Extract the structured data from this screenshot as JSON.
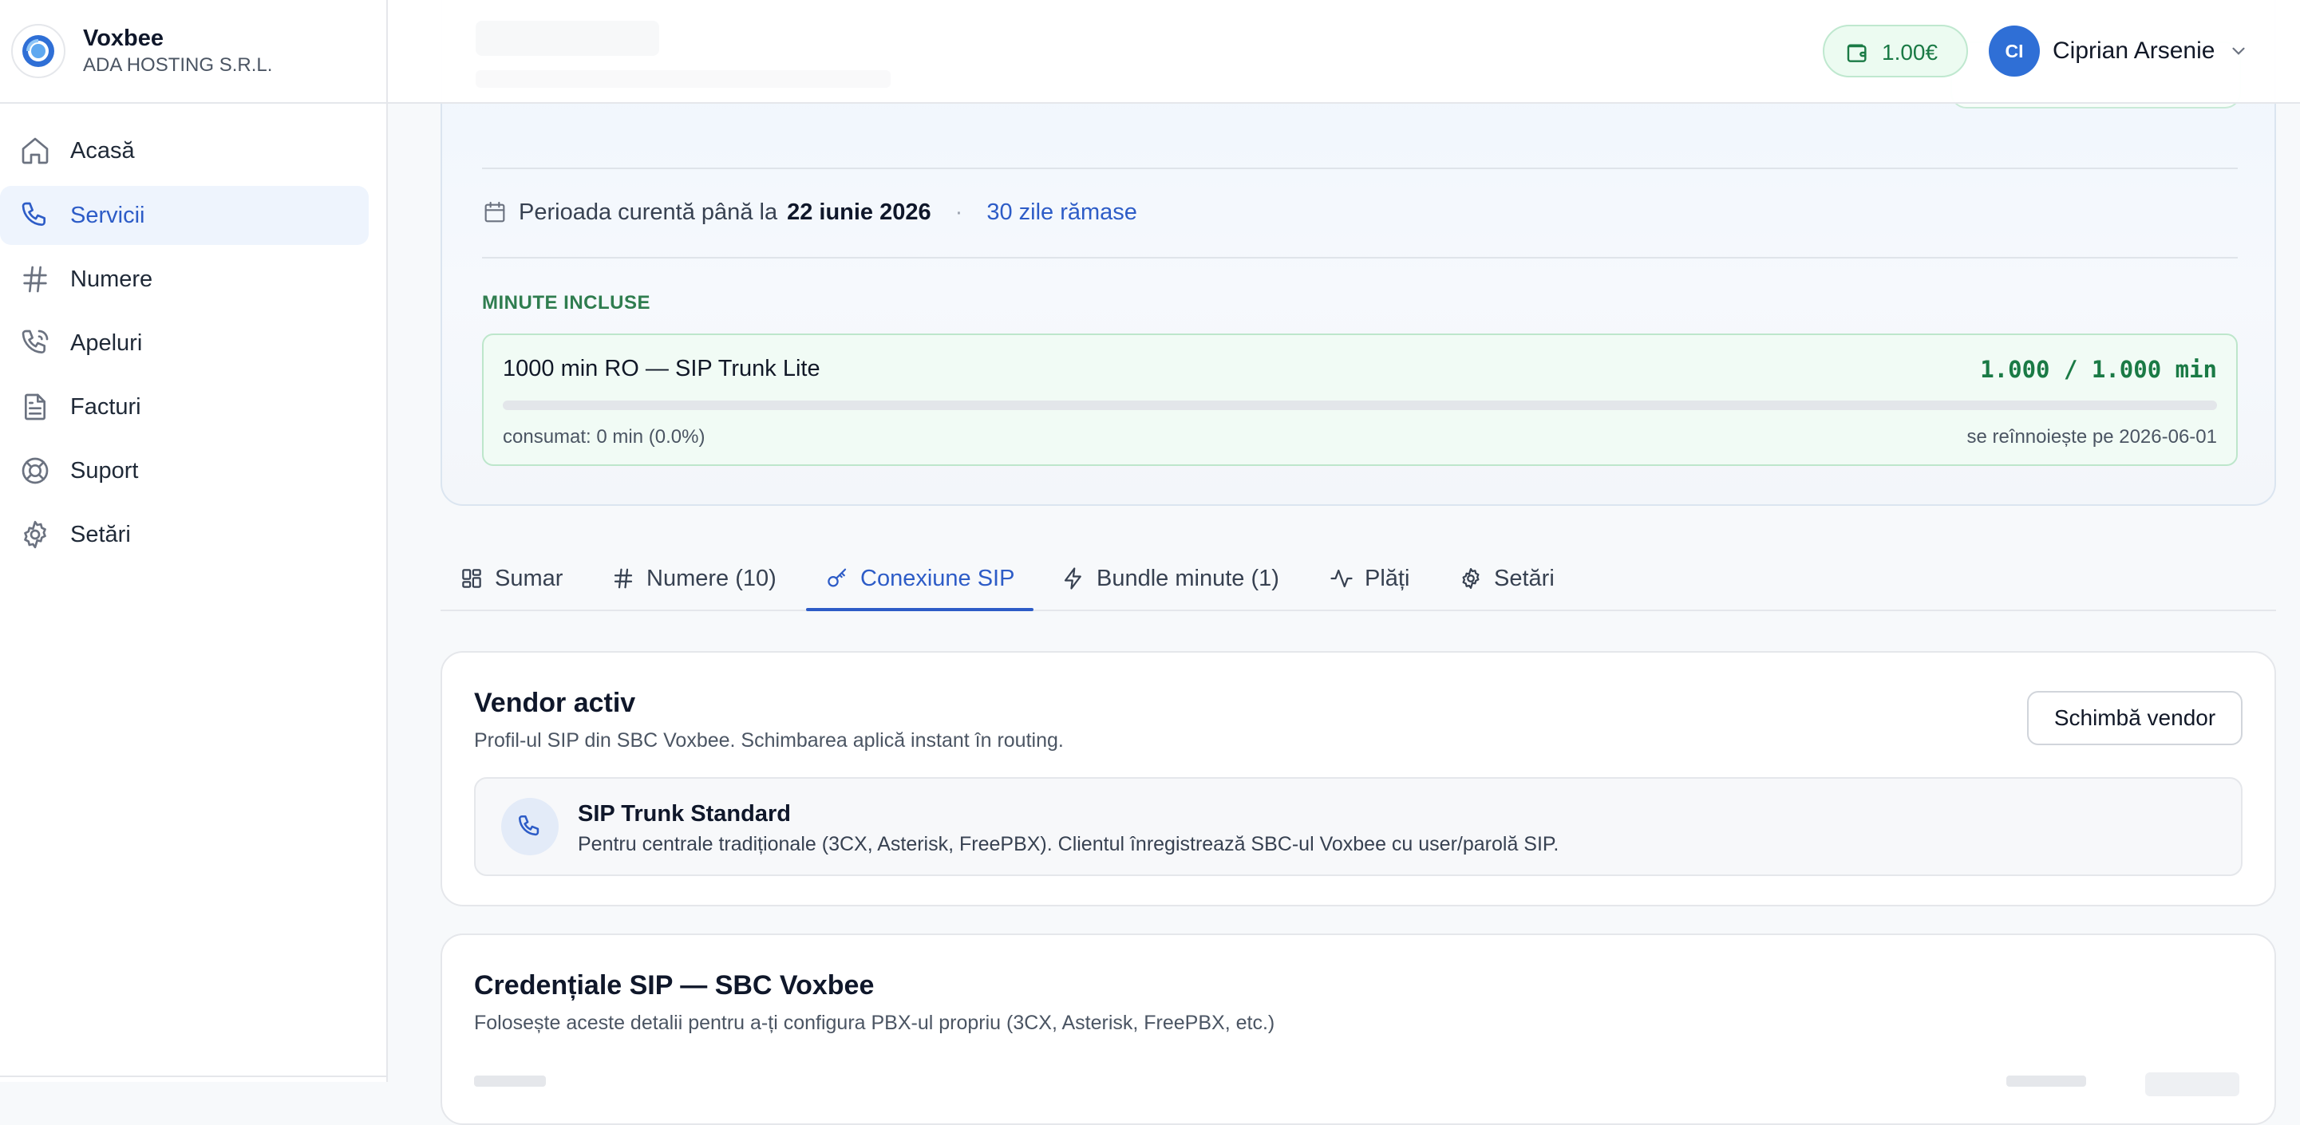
{
  "brand": {
    "name": "Voxbee",
    "org": "ADA HOSTING S.R.L."
  },
  "sidebar": {
    "items": [
      {
        "label": "Acasă",
        "icon": "home-icon"
      },
      {
        "label": "Servicii",
        "icon": "phone-icon",
        "active": true
      },
      {
        "label": "Numere",
        "icon": "hash-icon"
      },
      {
        "label": "Apeluri",
        "icon": "phone-call-icon"
      },
      {
        "label": "Facturi",
        "icon": "file-icon"
      },
      {
        "label": "Suport",
        "icon": "lifebuoy-icon"
      },
      {
        "label": "Setări",
        "icon": "gear-icon"
      }
    ]
  },
  "header": {
    "balance": "1.00€",
    "user_initials": "CI",
    "user_name": "Ciprian Arsenie"
  },
  "period": {
    "label": "Perioada curentă până la",
    "date": "22 iunie 2026",
    "separator": "·",
    "remaining": "30 zile rămase"
  },
  "minutes": {
    "section_title": "MINUTE INCLUSE",
    "bundle_name": "1000 min RO — SIP Trunk Lite",
    "quota": "1.000 / 1.000 min",
    "consumed_fraction": 0.0,
    "consumed": "consumat: 0 min (0.0%)",
    "renews": "se reînnoiește pe 2026-06-01"
  },
  "tabs": [
    {
      "label": "Sumar",
      "icon": "grid-icon"
    },
    {
      "label": "Numere (10)",
      "icon": "hash-icon"
    },
    {
      "label": "Conexiune SIP",
      "icon": "key-icon",
      "active": true
    },
    {
      "label": "Bundle minute (1)",
      "icon": "zap-icon"
    },
    {
      "label": "Plăți",
      "icon": "activity-icon"
    },
    {
      "label": "Setări",
      "icon": "gear-icon"
    }
  ],
  "vendor": {
    "title": "Vendor activ",
    "subtitle": "Profil-ul SIP din SBC Voxbee. Schimbarea aplică instant în routing.",
    "change_button": "Schimbă vendor",
    "profile_name": "SIP Trunk Standard",
    "profile_desc": "Pentru centrale tradiționale (3CX, Asterisk, FreePBX). Clientul înregistrează SBC-ul Voxbee cu user/parolă SIP."
  },
  "credentials": {
    "title": "Credențiale SIP — SBC Voxbee",
    "subtitle": "Folosește aceste detalii pentru a-ți configura PBX-ul propriu (3CX, Asterisk, FreePBX, etc.)"
  },
  "colors": {
    "accent": "#2d5cc7",
    "success": "#1a7a45",
    "avatar": "#2f6fd6"
  }
}
